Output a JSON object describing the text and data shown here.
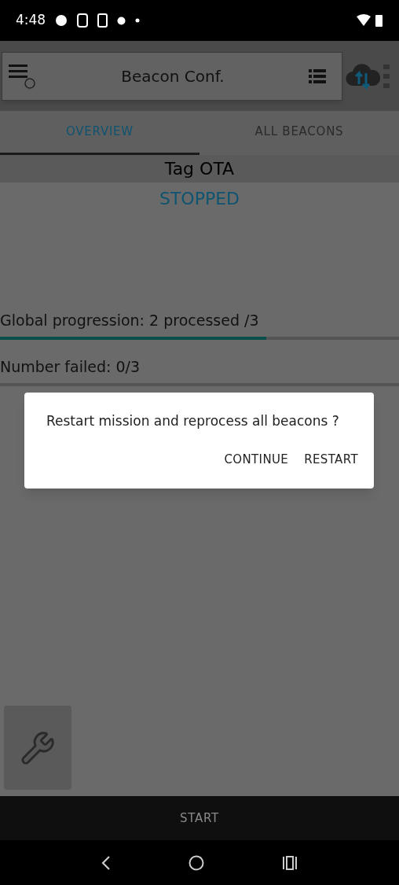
{
  "status_bar": {
    "time": "4:48"
  },
  "app_bar": {
    "title": "Beacon Conf."
  },
  "tabs": [
    {
      "label": "OVERVIEW",
      "selected": true
    },
    {
      "label": "ALL BEACONS",
      "selected": false
    }
  ],
  "section_title": "Tag OTA",
  "mission_state": "STOPPED",
  "progress": [
    {
      "label": "Global progression: 2 processed /3",
      "level": 0.667
    },
    {
      "label": "Number failed: 0/3"
    }
  ],
  "dialog": {
    "message": "Restart mission and reprocess all beacons ?",
    "buttons": [
      "CONTINUE",
      "RESTART"
    ]
  },
  "bottom_button": "START"
}
